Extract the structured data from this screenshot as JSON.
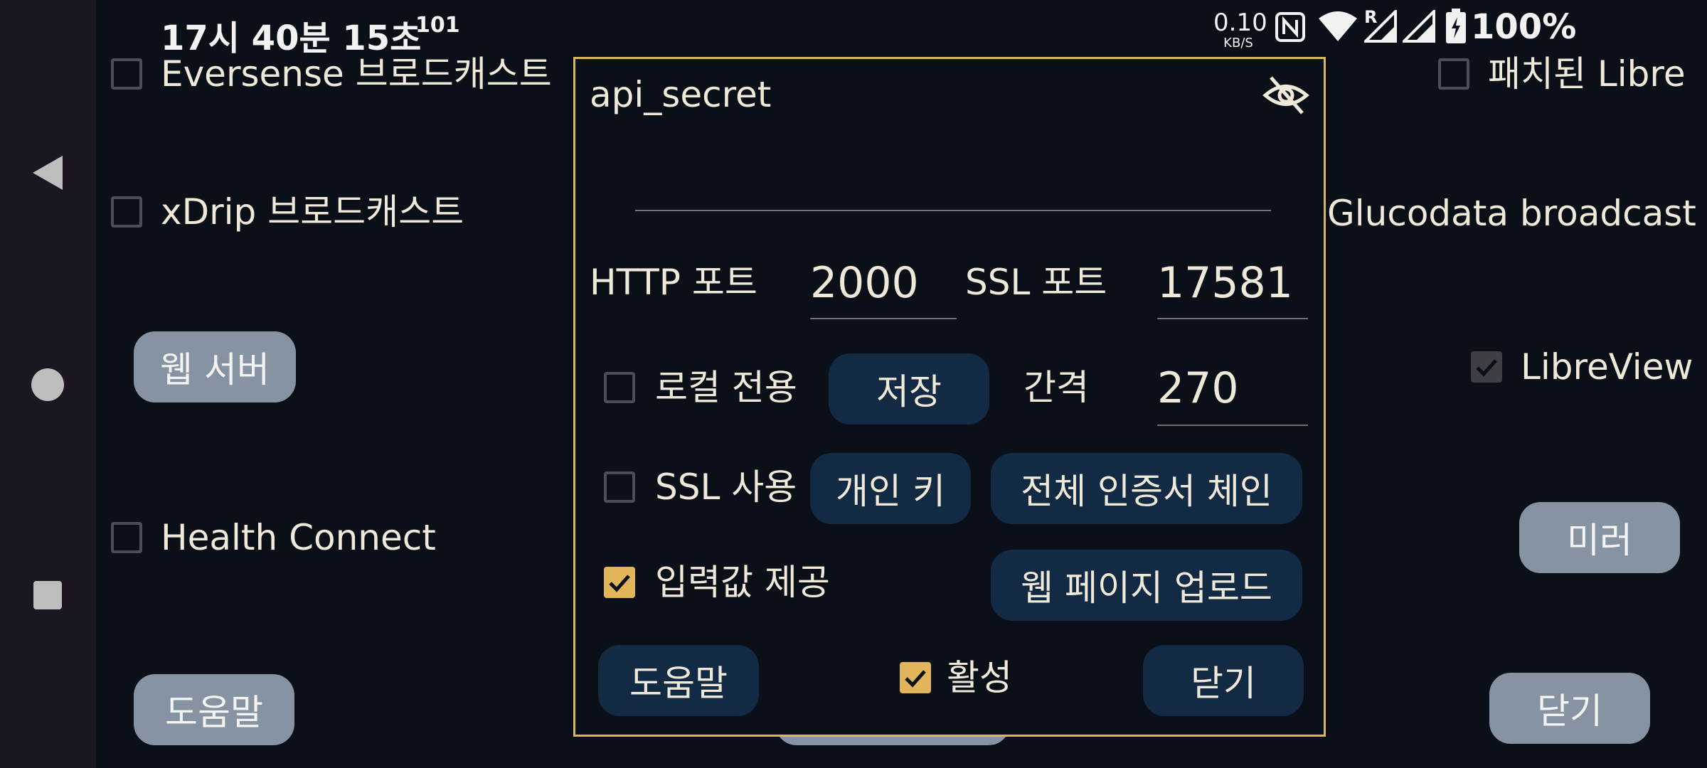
{
  "status_bar": {
    "time": "17시 40분 15초",
    "notification_count": "101",
    "net_speed": "0.10",
    "net_speed_unit": "KB/S",
    "roaming_indicator": "R",
    "battery": "100%",
    "icons": [
      "nfc-icon",
      "wifi-icon",
      "signal-icon",
      "signal-icon",
      "battery-charging-icon"
    ]
  },
  "nav": {
    "items": [
      "back-icon",
      "home-icon",
      "recents-icon"
    ]
  },
  "background": {
    "left_options": [
      {
        "label": "Eversense 브로드캐스트",
        "checked": false
      },
      {
        "label": "xDrip 브로드캐스트",
        "checked": false
      },
      {
        "label": "Health Connect",
        "checked": false
      }
    ],
    "web_server_button": "웹 서버",
    "help_button": "도움말",
    "right_options": [
      {
        "label": "패치된 Libre",
        "checked": false
      },
      {
        "label": "Glucodata broadcast",
        "checked": false
      },
      {
        "label": "LibreView",
        "checked": true
      }
    ],
    "mirror_button": "미러",
    "close_button": "닫기"
  },
  "dialog": {
    "api_secret_label": "api_secret",
    "api_secret_value": "",
    "http_port_label": "HTTP 포트",
    "http_port_value": "2000",
    "ssl_port_label": "SSL 포트",
    "ssl_port_value": "17581",
    "local_only_label": "로컬 전용",
    "local_only_checked": false,
    "save_button": "저장",
    "interval_label": "간격",
    "interval_value": "270",
    "use_ssl_label": "SSL 사용",
    "use_ssl_checked": false,
    "private_key_button": "개인 키",
    "full_chain_button": "전체 인증서 체인",
    "provide_input_label": "입력값 제공",
    "provide_input_checked": true,
    "upload_web_button": "웹 페이지 업로드",
    "help_button": "도움말",
    "active_label": "활성",
    "active_checked": true,
    "close_button": "닫기"
  },
  "colors": {
    "background": "#0b0f17",
    "dialog_border": "#d7b561",
    "accent_check": "#e2b55a",
    "navy_button": "#132a44",
    "gray_button": "#8593a3",
    "text": "#efe9da"
  }
}
